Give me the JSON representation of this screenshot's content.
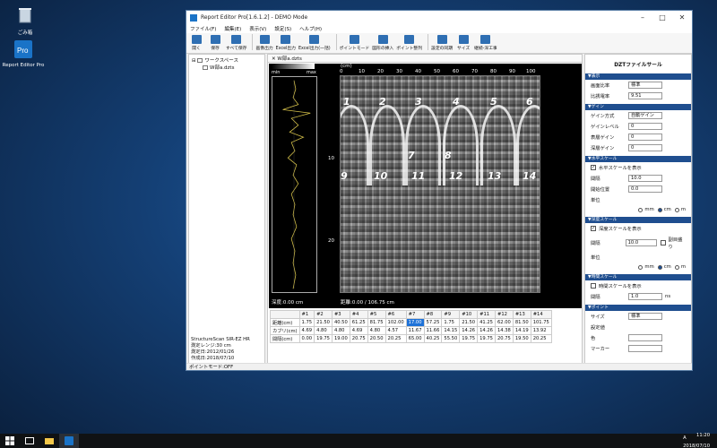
{
  "desktop": {
    "trash_label": "ごみ箱",
    "app_label": "Report Editor Pro"
  },
  "window": {
    "title": "Report Editor Pro[1.6.1.2] - DEMO Mode",
    "menu": [
      "ファイル(F)",
      "編集(E)",
      "表示(V)",
      "設定(S)",
      "ヘルプ(H)"
    ]
  },
  "toolbar": {
    "buttons": [
      "開く",
      "保存",
      "すべて保存",
      "画像出力",
      "Excel出力",
      "Excel出力(一括)",
      "ポイントモード",
      "図形の挿入",
      "ポイント整列",
      "設定の同期",
      "サイズ",
      "継続-深工事"
    ]
  },
  "tree": {
    "root": "ワークスペース",
    "file": "W部a.dzts"
  },
  "device_info": {
    "model": "StructureScan SIR-EZ HR",
    "range": "測定レンジ:30 cm",
    "measured": "測定日:2012/01/26",
    "created": "作成日:2018/07/10"
  },
  "document": {
    "tab": "W部a.dzts",
    "legend_min": "min",
    "legend_max": "max",
    "unit_label": "(cm)",
    "x_ticks": [
      "0",
      "10",
      "20",
      "30",
      "40",
      "50",
      "60",
      "70",
      "80",
      "90",
      "100"
    ],
    "y_ticks": [
      "10",
      "20"
    ],
    "markers": [
      "1",
      "2",
      "3",
      "4",
      "5",
      "6",
      "7",
      "8",
      "9",
      "10",
      "11",
      "12",
      "13",
      "14"
    ],
    "depth_readout": "深度:0.00 cm",
    "distance_readout": "距離:0.00 / 106.75 cm"
  },
  "points_table": {
    "headers": [
      "",
      "#1",
      "#2",
      "#3",
      "#4",
      "#5",
      "#6",
      "#7",
      "#8",
      "#9",
      "#10",
      "#11",
      "#12",
      "#13",
      "#14"
    ],
    "rows": [
      [
        "距離(cm)",
        "1.75",
        "21.50",
        "40.50",
        "61.25",
        "81.75",
        "102.00",
        "17.00",
        "57.25",
        "1.75",
        "21.50",
        "41.25",
        "62.00",
        "81.50",
        "101.75"
      ],
      [
        "カブリ(cm)",
        "4.69",
        "4.80",
        "4.80",
        "4.69",
        "4.80",
        "4.57",
        "11.67",
        "11.66",
        "14.15",
        "14.26",
        "14.26",
        "14.38",
        "14.19",
        "13.92"
      ],
      [
        "間隔(cm)",
        "0.00",
        "19.75",
        "19.00",
        "20.75",
        "20.50",
        "20.25",
        "65.00",
        "40.25",
        "55.50",
        "19.75",
        "19.75",
        "20.75",
        "19.50",
        "20.25"
      ]
    ]
  },
  "properties": {
    "title": "DZTファイルサール",
    "sec_display": "▼表示",
    "ratio_label": "画面比率",
    "ratio_value": "標準",
    "permittivity_label": "比誘電率",
    "permittivity_value": "9.51",
    "sec_gain": "▼ゲイン",
    "gain_mode_label": "ゲイン方式",
    "gain_mode_value": "自動ゲイン",
    "gain_level_label": "ゲインレベル",
    "gain_level_value": "0",
    "surface_gain_label": "表層ゲイン",
    "surface_gain_value": "0",
    "deep_gain_label": "深層ゲイン",
    "deep_gain_value": "0",
    "sec_hscale": "▼水平スケール",
    "hscale_show": "水平スケールを表示",
    "h_interval_label": "間隔",
    "h_interval_value": "10.0",
    "start_label": "開始位置",
    "start_value": "0.0",
    "unit_label": "単位",
    "unit_mm": "mm",
    "unit_cm": "cm",
    "unit_m": "m",
    "sec_vscale": "▼深度スケール",
    "vscale_show": "深度スケールを表示",
    "v_interval_label": "間隔",
    "v_interval_value": "10.0",
    "aux_label": "副目盛り",
    "sec_time": "▼時間スケール",
    "time_show": "時間スケールを表示",
    "t_interval_label": "間隔",
    "t_interval_value": "1.0",
    "t_unit": "ns",
    "sec_point": "▼ポイント",
    "size_label": "サイズ",
    "size_value": "標準",
    "setting_label": "設定値",
    "color_label": "色",
    "marker_label": "マーカー"
  },
  "status": "ポイントモード:OFF",
  "tray": {
    "time": "11:20",
    "date": "2018/07/10",
    "ime": "A"
  }
}
